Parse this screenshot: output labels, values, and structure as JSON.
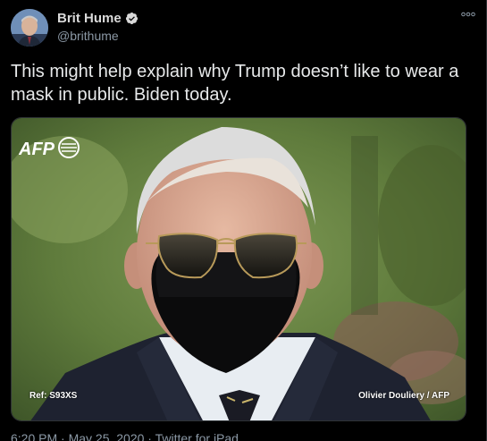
{
  "author": {
    "display_name": "Brit Hume",
    "handle": "@brithume",
    "verified": true
  },
  "more_menu": "…",
  "tweet": {
    "text": "This might help explain why Trump doesn’t like to wear a mask in public. Biden today."
  },
  "media": {
    "agency_logo": "AFP",
    "ref": "Ref: S93XS",
    "credit": "Olivier Douliery / AFP"
  },
  "meta": {
    "partial_text": "6:20 PM · May 25, 2020 · Twitter for iPad"
  },
  "colors": {
    "background": "#000000",
    "text": "#e7e9ea",
    "secondary": "#8b98a5",
    "verified": "#d9d9d9"
  }
}
